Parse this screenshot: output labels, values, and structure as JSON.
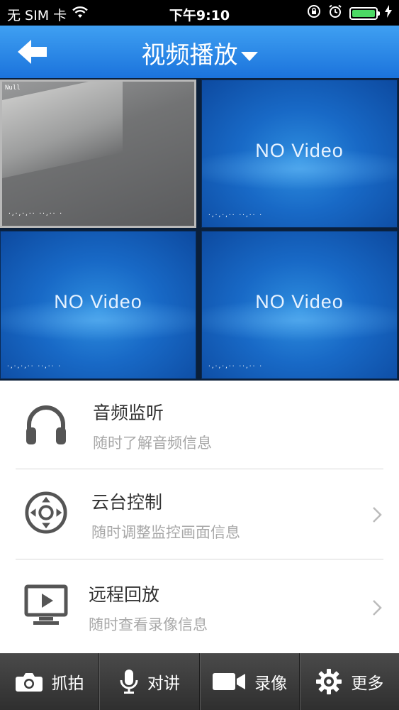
{
  "status_bar": {
    "carrier": "无 SIM 卡",
    "time": "下午9:10",
    "battery_percent": 90
  },
  "nav": {
    "title": "视频播放",
    "back_icon": "back-arrow-icon",
    "dropdown_icon": "caret-down-icon"
  },
  "video_grid": {
    "cells": [
      {
        "state": "live",
        "timestamp": "Null",
        "osd": "·,·,·,·· ··,·· ·"
      },
      {
        "state": "no_video",
        "label": "NO   Video",
        "osd": "·,·,·,·· ··,·· ·"
      },
      {
        "state": "no_video",
        "label": "NO   Video",
        "osd": "·,·,·,·· ··,·· ·"
      },
      {
        "state": "no_video",
        "label": "NO   Video",
        "osd": "·,·,·,·· ··,·· ·"
      }
    ]
  },
  "features": [
    {
      "title": "音频监听",
      "subtitle": "随时了解音频信息",
      "icon": "headphones-icon",
      "has_chevron": false
    },
    {
      "title": "云台控制",
      "subtitle": "随时调整监控画面信息",
      "icon": "ptz-control-icon",
      "has_chevron": true
    },
    {
      "title": "远程回放",
      "subtitle": "随时查看录像信息",
      "icon": "playback-monitor-icon",
      "has_chevron": true
    }
  ],
  "toolbar": {
    "snapshot": "抓拍",
    "talk": "对讲",
    "record": "录像",
    "more": "更多"
  },
  "colors": {
    "nav_blue": "#2586e8",
    "toolbar_dark": "#3a3a3a",
    "battery_green": "#4cd964"
  }
}
